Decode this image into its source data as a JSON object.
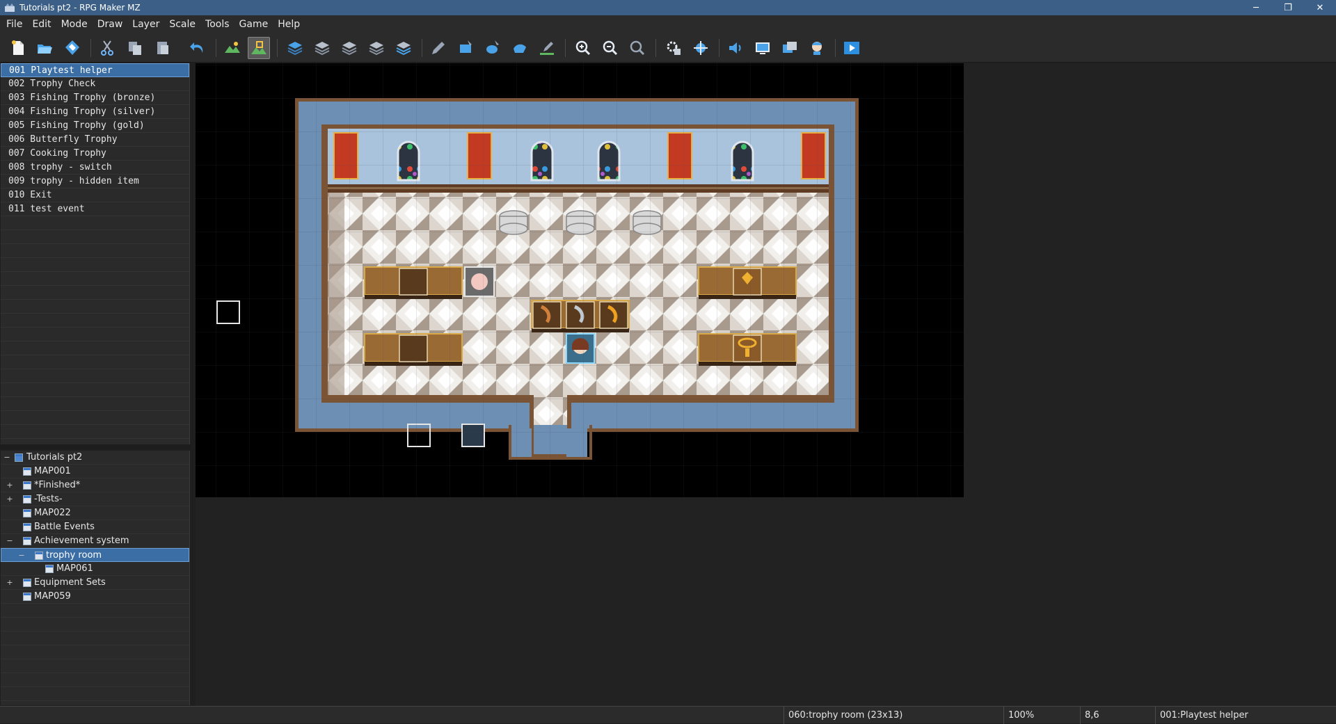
{
  "window": {
    "title": "Tutorials pt2 - RPG Maker MZ",
    "minimize": "─",
    "maximize": "❐",
    "close": "✕"
  },
  "menu": [
    "File",
    "Edit",
    "Mode",
    "Draw",
    "Layer",
    "Scale",
    "Tools",
    "Game",
    "Help"
  ],
  "toolbar": {
    "buttons": [
      "new-project-icon",
      "open-project-icon",
      "save-project-icon",
      "cut-icon",
      "copy-icon",
      "paste-icon",
      "undo-icon",
      "map-mode-icon",
      "event-mode-icon",
      "layer-a-icon",
      "layer-b-icon",
      "layer-c-icon",
      "layer-d-icon",
      "layer-auto-icon",
      "pencil-icon",
      "rectangle-icon",
      "ellipse-icon",
      "flood-fill-icon",
      "shadow-pen-icon",
      "zoom-in-icon",
      "zoom-out-icon",
      "actual-size-icon",
      "database-icon",
      "plugin-manager-icon",
      "sound-test-icon",
      "event-searcher-icon",
      "resource-manager-icon",
      "character-generator-icon",
      "playtest-icon"
    ],
    "active": "event-mode-icon"
  },
  "events": [
    {
      "label": "001 Playtest helper",
      "selected": true
    },
    {
      "label": "002 Trophy Check"
    },
    {
      "label": "003 Fishing Trophy (bronze)"
    },
    {
      "label": "004 Fishing Trophy (silver)"
    },
    {
      "label": "005 Fishing Trophy (gold)"
    },
    {
      "label": "006 Butterfly Trophy"
    },
    {
      "label": "007 Cooking Trophy"
    },
    {
      "label": "008 trophy - switch"
    },
    {
      "label": "009 trophy - hidden item"
    },
    {
      "label": "010 Exit"
    },
    {
      "label": "011 test event"
    }
  ],
  "map_tree": [
    {
      "label": "Tutorials pt2",
      "depth": 0,
      "toggle": "−",
      "root": true
    },
    {
      "label": "MAP001",
      "depth": 1,
      "toggle": ""
    },
    {
      "label": "*Finished*",
      "depth": 1,
      "toggle": "+"
    },
    {
      "label": "-Tests-",
      "depth": 1,
      "toggle": "+"
    },
    {
      "label": "MAP022",
      "depth": 1,
      "toggle": ""
    },
    {
      "label": "Battle Events",
      "depth": 1,
      "toggle": ""
    },
    {
      "label": "Achievement system",
      "depth": 1,
      "toggle": "−"
    },
    {
      "label": "trophy room",
      "depth": 2,
      "toggle": "−",
      "selected": true
    },
    {
      "label": "MAP061",
      "depth": 3,
      "toggle": ""
    },
    {
      "label": "Equipment Sets",
      "depth": 1,
      "toggle": "+"
    },
    {
      "label": "MAP059",
      "depth": 1,
      "toggle": ""
    }
  ],
  "status": {
    "map": "060:trophy room (23x13)",
    "zoom": "100%",
    "coords": "8,6",
    "event": "001:Playtest helper"
  },
  "colors": {
    "accent": "#3a6ea5",
    "titlebar": "#3b5f87"
  }
}
